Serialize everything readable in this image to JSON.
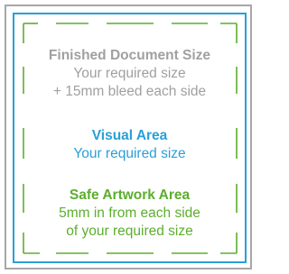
{
  "colors": {
    "bleed": "#a7a7a7",
    "visual": "#2a9fd8",
    "safe": "#5cae2d"
  },
  "finished": {
    "heading": "Finished Document Size",
    "lines": [
      "Your required size",
      "+ 15mm bleed each side"
    ]
  },
  "visual": {
    "heading": "Visual Area",
    "lines": [
      "Your required size"
    ]
  },
  "safe": {
    "heading": "Safe Artwork Area",
    "lines": [
      "5mm in from each side",
      "of your required size"
    ]
  }
}
